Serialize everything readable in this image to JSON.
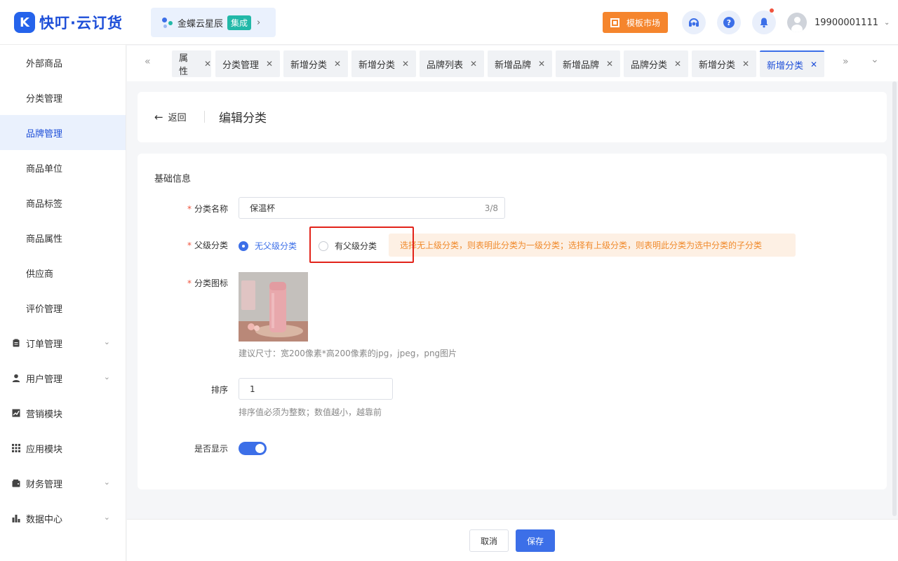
{
  "brand": {
    "name": "快叮·云订货",
    "logo_letter": "K"
  },
  "integration": {
    "name": "金蝶云星辰",
    "badge": "集成",
    "arrow": "›"
  },
  "header": {
    "market_label": "模板市场",
    "help_glyph": "?",
    "username": "19900001111",
    "user_caret": "⌄"
  },
  "sidebar": {
    "items": [
      {
        "label": "外部商品"
      },
      {
        "label": "分类管理"
      },
      {
        "label": "品牌管理",
        "active": true
      },
      {
        "label": "商品单位"
      },
      {
        "label": "商品标签"
      },
      {
        "label": "商品属性"
      },
      {
        "label": "供应商"
      },
      {
        "label": "评价管理"
      }
    ],
    "groups": [
      {
        "label": "订单管理",
        "icon": "clipboard-icon"
      },
      {
        "label": "用户管理",
        "icon": "user-icon"
      },
      {
        "label": "营销模块",
        "icon": "chart-icon"
      },
      {
        "label": "应用模块",
        "icon": "grid-icon"
      },
      {
        "label": "财务管理",
        "icon": "wallet-icon"
      },
      {
        "label": "数据中心",
        "icon": "bar-chart-icon"
      }
    ]
  },
  "tabs": {
    "prev_glyph": "«",
    "next_glyph": "»",
    "more_glyph": "⌄",
    "close_glyph": "✕",
    "items": [
      {
        "label": "属性"
      },
      {
        "label": "分类管理"
      },
      {
        "label": "新增分类"
      },
      {
        "label": "新增分类"
      },
      {
        "label": "品牌列表"
      },
      {
        "label": "新增品牌"
      },
      {
        "label": "新增品牌"
      },
      {
        "label": "品牌分类"
      },
      {
        "label": "新增分类"
      },
      {
        "label": "新增分类",
        "active": true
      }
    ]
  },
  "page": {
    "back_label": "返回",
    "back_glyph": "←",
    "title": "编辑分类"
  },
  "form": {
    "section_title": "基础信息",
    "required_mark": "*",
    "name": {
      "label": "分类名称",
      "value": "保温杯",
      "counter": "3/8"
    },
    "parent": {
      "label": "父级分类",
      "options": [
        {
          "label": "无父级分类",
          "selected": true
        },
        {
          "label": "有父级分类",
          "selected": false
        }
      ],
      "tip": "选择无上级分类，则表明此分类为一级分类；选择有上级分类，则表明此分类为选中分类的子分类"
    },
    "icon": {
      "label": "分类图标",
      "hint": "建议尺寸：宽200像素*高200像素的jpg，jpeg，png图片"
    },
    "sort": {
      "label": "排序",
      "value": "1",
      "hint": "排序值必须为整数；数值越小，越靠前"
    },
    "visible": {
      "label": "是否显示",
      "on": true
    }
  },
  "footer": {
    "cancel_label": "取消",
    "save_label": "保存"
  },
  "colors": {
    "primary": "#3c6fe8",
    "brand": "#1d4ed8",
    "market": "#f5852d",
    "tip_bg": "#fdf0e4",
    "tip_text": "#f08a2c",
    "highlight": "#e2231a"
  }
}
